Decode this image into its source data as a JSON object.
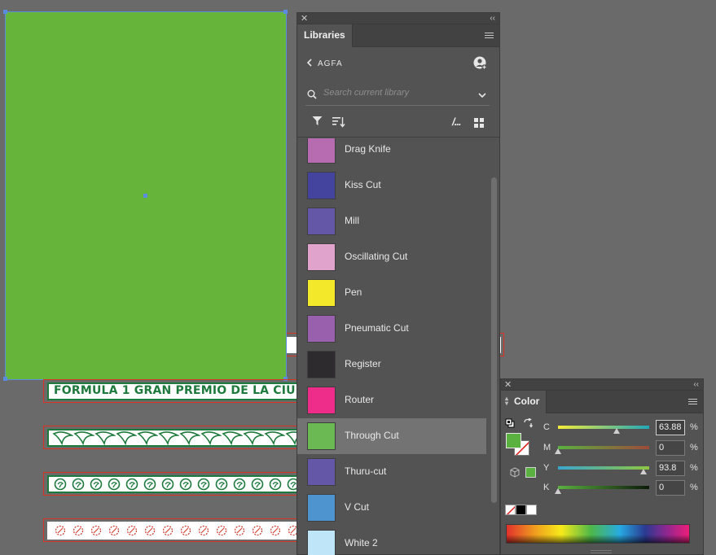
{
  "canvas": {
    "banner_text": "FORMULA 1 GRAN PREMIO DE LA CIU"
  },
  "libraries_panel": {
    "tab_label": "Libraries",
    "library_name": "AGFA",
    "search_placeholder": "Search current library",
    "list_view_icon_text": "/...",
    "swatches": [
      {
        "label": "Drag Knife",
        "color": "#b76bb0"
      },
      {
        "label": "Kiss Cut",
        "color": "#44449e"
      },
      {
        "label": "Mill",
        "color": "#6557a8"
      },
      {
        "label": "Oscillating Cut",
        "color": "#e0a4cc"
      },
      {
        "label": "Pen",
        "color": "#f4e82a"
      },
      {
        "label": "Pneumatic Cut",
        "color": "#9960ad"
      },
      {
        "label": "Register",
        "color": "#2e2b2e"
      },
      {
        "label": "Router",
        "color": "#ee2c8a"
      },
      {
        "label": "Through Cut",
        "color": "#6bb952"
      },
      {
        "label": "Thuru-cut",
        "color": "#6557a8"
      },
      {
        "label": "V Cut",
        "color": "#4e95d0"
      },
      {
        "label": "White 2",
        "color": "#bfe5f8"
      }
    ],
    "selected_swatch": "Through Cut"
  },
  "color_panel": {
    "tab_label": "Color",
    "fill_color": "#5ab13f",
    "sliders": [
      {
        "label": "C",
        "value": "63.88",
        "unit": "%",
        "level": 0.6388
      },
      {
        "label": "M",
        "value": "0",
        "unit": "%",
        "level": 0
      },
      {
        "label": "Y",
        "value": "93.8",
        "unit": "%",
        "level": 0.938
      },
      {
        "label": "K",
        "value": "0",
        "unit": "%",
        "level": 0
      }
    ]
  }
}
